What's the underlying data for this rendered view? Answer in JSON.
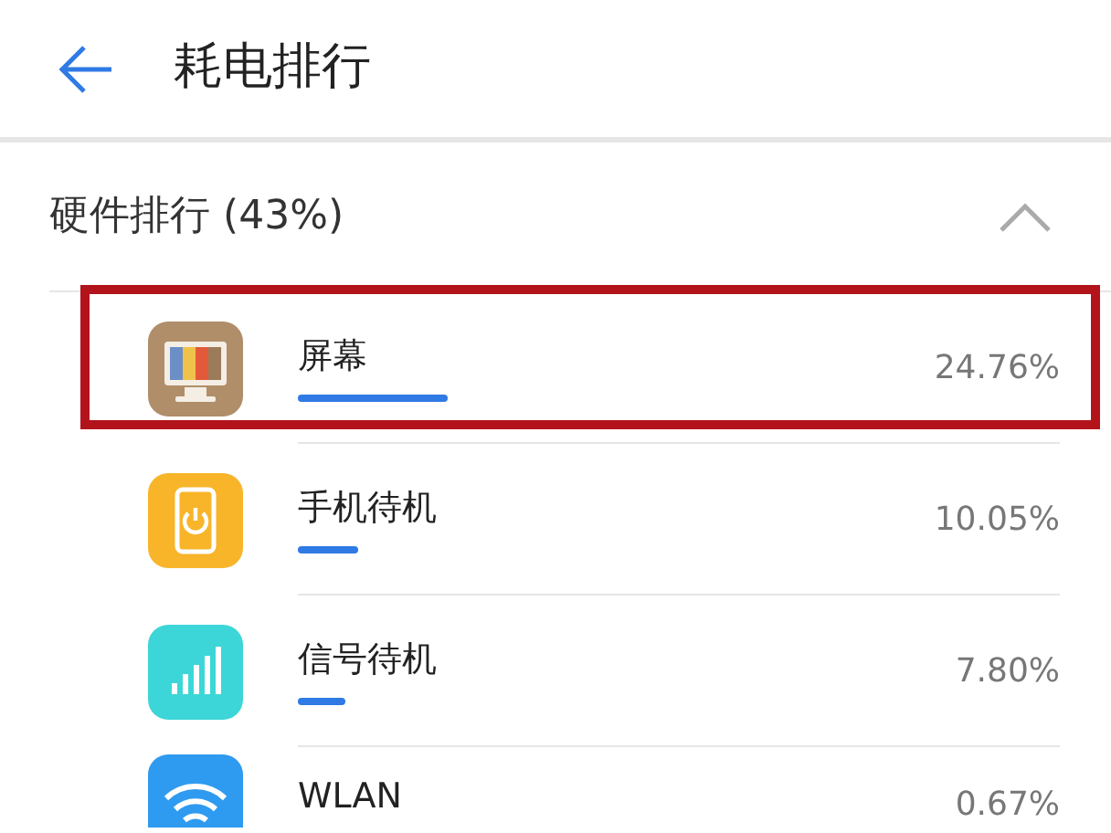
{
  "header": {
    "title": "耗电排行"
  },
  "section": {
    "title": "硬件排行 (43%)",
    "expanded": true
  },
  "items": [
    {
      "kind": "monitor",
      "name": "屏幕",
      "level": 0.2476,
      "percent": "24.76%",
      "highlighted": true
    },
    {
      "kind": "phone",
      "name": "手机待机",
      "level": 0.1005,
      "percent": "10.05%",
      "highlighted": false
    },
    {
      "kind": "signal",
      "name": "信号待机",
      "level": 0.078,
      "percent": "7.80%",
      "highlighted": false
    },
    {
      "kind": "wifi",
      "name": "WLAN",
      "percent": "0.67%",
      "highlighted": false
    }
  ]
}
